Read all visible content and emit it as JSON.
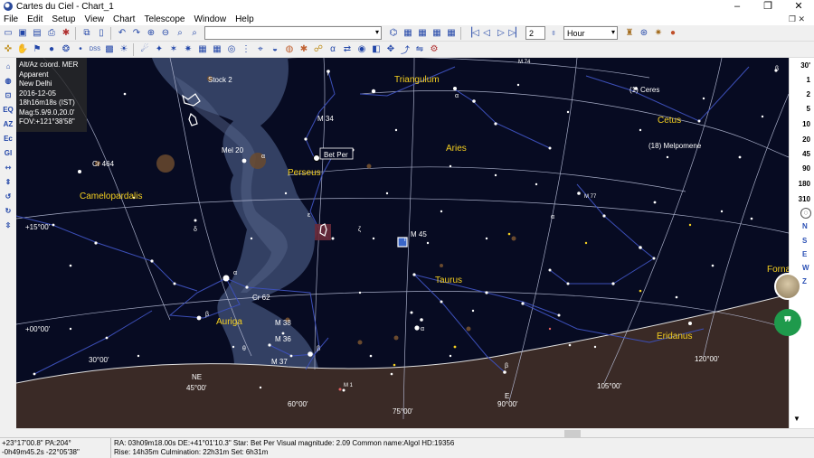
{
  "window": {
    "title": "Cartes du Ciel - Chart_1",
    "buttons": [
      "–",
      "❐",
      "✕"
    ]
  },
  "menu": {
    "items": [
      "File",
      "Edit",
      "Setup",
      "View",
      "Chart",
      "Telescope",
      "Window",
      "Help"
    ]
  },
  "toolbar": {
    "search_value": "",
    "step_value": "2",
    "time_unit": "Hour"
  },
  "info_panel": {
    "lines": [
      "Alt/Az coord. MER",
      "Apparent",
      "New Delhi",
      "2016-12-05",
      "18h16m18s (IST)",
      "Mag:5.9/9.0,20.0'",
      "FOV:+121°38'58\""
    ]
  },
  "fov_scale": [
    "30'",
    "1",
    "2",
    "5",
    "10",
    "20",
    "45",
    "90",
    "180",
    "310"
  ],
  "directions": [
    "N",
    "S",
    "E",
    "W",
    "Z"
  ],
  "sky_labels": {
    "constellations": [
      "Triangulum",
      "Perseus",
      "Aries",
      "Cetus",
      "Camelopardalis",
      "Taurus",
      "Auriga",
      "Eridanus",
      "Forna"
    ],
    "objects": [
      "Stock 2",
      "M 34",
      "Mel 20",
      "Cr 464",
      "M 77",
      "M 45",
      "Cr 62",
      "M 38",
      "M 36",
      "M 37",
      "M 1",
      "M 74"
    ],
    "named": [
      "(1) Ceres",
      "(18) Melpomene",
      "Bet Per"
    ],
    "greek": [
      "γ",
      "β",
      "α",
      "α",
      "α",
      "δ",
      "ε",
      "ζ",
      "η",
      "α",
      "β",
      "θ",
      "β",
      "α",
      "β"
    ],
    "grid_dec": [
      "+15°00'",
      "+00°00'"
    ],
    "grid_ra": [
      "30°00'",
      "45°00'",
      "60°00'",
      "75°00'",
      "90°00'",
      "105°00'",
      "120°00'"
    ],
    "horizon": [
      "NE",
      "E"
    ]
  },
  "status": {
    "left_line1": "+23°17'00.8\" PA:204°",
    "left_line2": "-0h49m45.2s -22°05'38\"",
    "mid_line1": "RA: 03h09m18.00s DE:+41°01'10.3\"  Star: Bet Per  Visual magnitude:  2.09  Common name:Algol  HD:19356",
    "mid_line2": "Rise: 14h35m   Culmination: 22h31m   Set: 6h31m"
  },
  "colors": {
    "sky_bg": "#070b22",
    "milkyway": "#3b4a6e",
    "horizon": "#3a2a26",
    "grid": "#b8bed8",
    "const_line": "#3c4fb8",
    "label_yellow": "#f5d020"
  }
}
